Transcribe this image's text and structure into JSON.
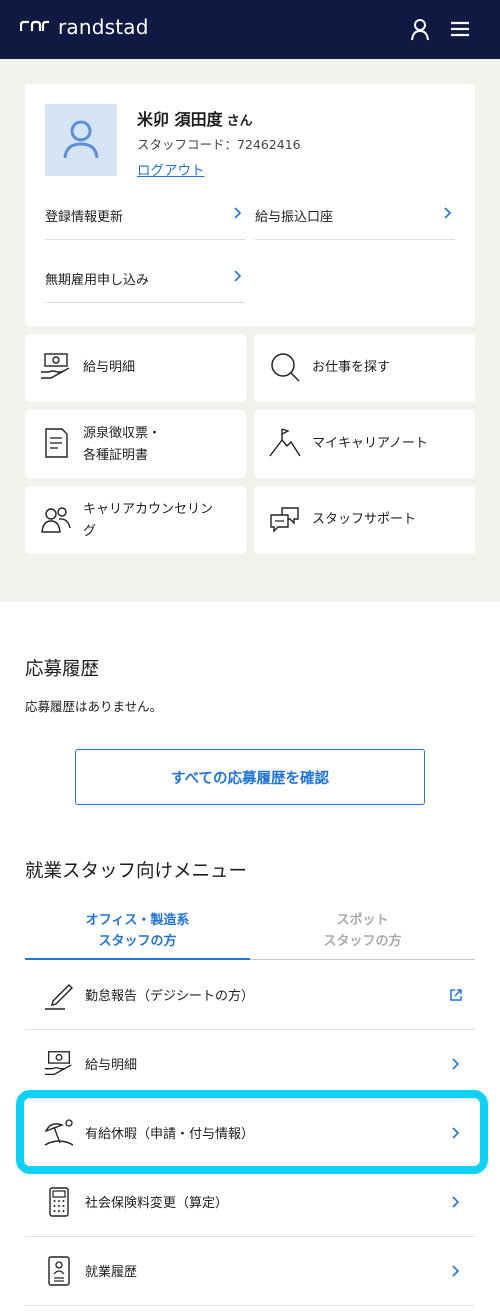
{
  "header": {
    "logo_text": "randstad",
    "account_icon": "person-icon",
    "menu_icon": "hamburger-icon"
  },
  "profile": {
    "name": "米卯 須田度",
    "honorific": "さん",
    "staff_code": "スタッフコード：72462416",
    "logout_label": "ログアウト",
    "links": [
      {
        "label": "登録情報更新"
      },
      {
        "label": "給与振込口座"
      },
      {
        "label": "無期雇用申し込み"
      }
    ]
  },
  "tiles": [
    {
      "label": "給与明細",
      "icon": "payslip-icon"
    },
    {
      "label": "お仕事を探す",
      "icon": "search-icon"
    },
    {
      "label_line1": "源泉徴収票・",
      "label_line2": "各種証明書",
      "icon": "document-icon"
    },
    {
      "label": "マイキャリアノート",
      "icon": "mountain-flag-icon"
    },
    {
      "label_line1": "キャリアカウンセリン",
      "label_line2": "グ",
      "icon": "people-icon"
    },
    {
      "label": "スタッフサポート",
      "icon": "chat-icon"
    }
  ],
  "applications": {
    "title": "応募履歴",
    "empty_text": "応募履歴はありません。",
    "view_all_label": "すべての応募履歴を確認"
  },
  "staff_menu": {
    "title": "就業スタッフ向けメニュー",
    "tabs": [
      {
        "line1": "オフィス・製造系",
        "line2": "スタッフの方",
        "active": true
      },
      {
        "line1": "スポット",
        "line2": "スタッフの方",
        "active": false
      }
    ],
    "items": [
      {
        "label": "勤怠報告（デジシートの方）",
        "icon": "pen-icon",
        "trailing": "external-link-icon"
      },
      {
        "label": "給与明細",
        "icon": "payslip-icon",
        "trailing": "chevron-right-icon"
      },
      {
        "label": "有給休暇（申請・付与情報）",
        "icon": "beach-umbrella-icon",
        "trailing": "chevron-right-icon"
      },
      {
        "label": "社会保険料変更（算定）",
        "icon": "calculator-icon",
        "trailing": "chevron-right-icon"
      },
      {
        "label": "就業履歴",
        "icon": "id-card-icon",
        "trailing": "chevron-right-icon"
      }
    ]
  },
  "colors": {
    "navy": "#0f1941",
    "accent": "#2175d9",
    "beige": "#f3f1ec",
    "highlight": "#0fd1f5"
  }
}
